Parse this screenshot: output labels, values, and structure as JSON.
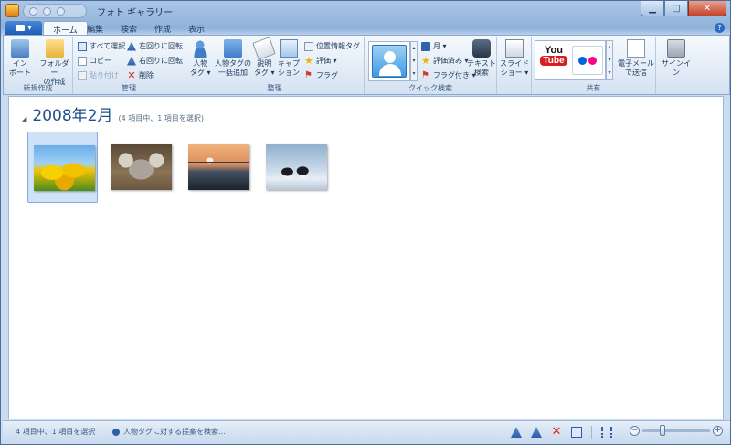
{
  "window": {
    "title": "フォト ギャラリー",
    "controls": {
      "minimize": "▁",
      "maximize": "□",
      "close": "✕"
    }
  },
  "ribbon": {
    "tabs": [
      "ホーム",
      "編集",
      "検索",
      "作成",
      "表示"
    ],
    "active_tab": "ホーム",
    "help": "?",
    "groups": {
      "new": {
        "label": "新規作成",
        "import": {
          "line1": "イン",
          "line2": "ポート"
        },
        "new_folder": {
          "line1": "フォルダー",
          "line2": "の作成"
        }
      },
      "manage": {
        "label": "管理",
        "select_all": "すべて選択",
        "copy": "コピー",
        "paste": "貼り付け",
        "rotate_left": "左回りに回転",
        "rotate_right": "右回りに回転",
        "delete": "削除"
      },
      "organize": {
        "label": "整理",
        "people_tag": {
          "line1": "人物",
          "line2": "タグ ▾"
        },
        "batch_people_tag": {
          "line1": "人物タグの",
          "line2": "一括追加"
        },
        "caption_tag": {
          "line1": "説明",
          "line2": "タグ ▾"
        },
        "caption": {
          "line1": "キャプ",
          "line2": "ション"
        },
        "geotag": "位置情報タグ",
        "rating": "評価 ▾",
        "flag": "フラグ"
      },
      "quick_find": {
        "label": "クイック検索",
        "month": "月 ▾",
        "rated": "評価済み ▾",
        "flagged": "フラグ付き ▾",
        "text_search": {
          "line1": "テキスト",
          "line2": "検索"
        }
      },
      "slideshow": {
        "slideshow": {
          "line1": "スライド",
          "line2": "ショー ▾"
        }
      },
      "share": {
        "label": "共有",
        "youtube": {
          "you": "You",
          "tube": "Tube"
        },
        "email": {
          "line1": "電子メール",
          "line2": "で送信"
        }
      },
      "signin": {
        "label": "サインイン"
      }
    }
  },
  "content": {
    "month_toggle": "◢",
    "month_title": "2008年2月",
    "count": "(4 項目中、1 項目を選択)",
    "photos": [
      {
        "name": "tulips",
        "selected": true
      },
      {
        "name": "koala",
        "selected": false
      },
      {
        "name": "lighthouse",
        "selected": false
      },
      {
        "name": "penguins",
        "selected": false
      }
    ]
  },
  "statusbar": {
    "selection": "4 項目中、1 項目を選択",
    "suggest": "人物タグに対する提案を検索...",
    "zoom": {
      "minus": "−",
      "plus": "+",
      "level": 0.28
    }
  }
}
